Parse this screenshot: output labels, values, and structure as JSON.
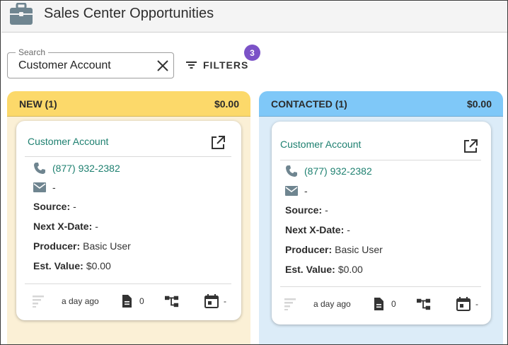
{
  "header": {
    "title": "Sales Center Opportunities",
    "icon": "briefcase-icon"
  },
  "search": {
    "legend": "Search",
    "value": "Customer Account"
  },
  "filters": {
    "label": "FILTERS",
    "badge_count": "3"
  },
  "colors": {
    "accent": "#1e8070",
    "badge": "#7b52c7",
    "new_header": "#fcd96a",
    "new_body": "#fbf0d6",
    "contacted_header": "#7fc8f8",
    "contacted_body": "#dcecf8"
  },
  "columns": [
    {
      "title": "NEW (1)",
      "total": "$0.00",
      "card": {
        "account": "Customer Account",
        "phone": "(877) 932-2382",
        "email": "-",
        "source_label": "Source:",
        "source_value": "-",
        "xdate_label": "Next X-Date:",
        "xdate_value": "-",
        "producer_label": "Producer:",
        "producer_value": "Basic User",
        "value_label": "Est. Value:",
        "value_value": "$0.00",
        "footer": {
          "time": "a day ago",
          "docs": "0",
          "tasks": "-"
        }
      }
    },
    {
      "title": "CONTACTED (1)",
      "total": "$0.00",
      "card": {
        "account": "Customer Account",
        "phone": "(877) 932-2382",
        "email": "-",
        "source_label": "Source:",
        "source_value": "-",
        "xdate_label": "Next X-Date:",
        "xdate_value": "-",
        "producer_label": "Producer:",
        "producer_value": "Basic User",
        "value_label": "Est. Value:",
        "value_value": "$0.00",
        "footer": {
          "time": "a day ago",
          "docs": "0",
          "tasks": "-"
        }
      }
    }
  ]
}
